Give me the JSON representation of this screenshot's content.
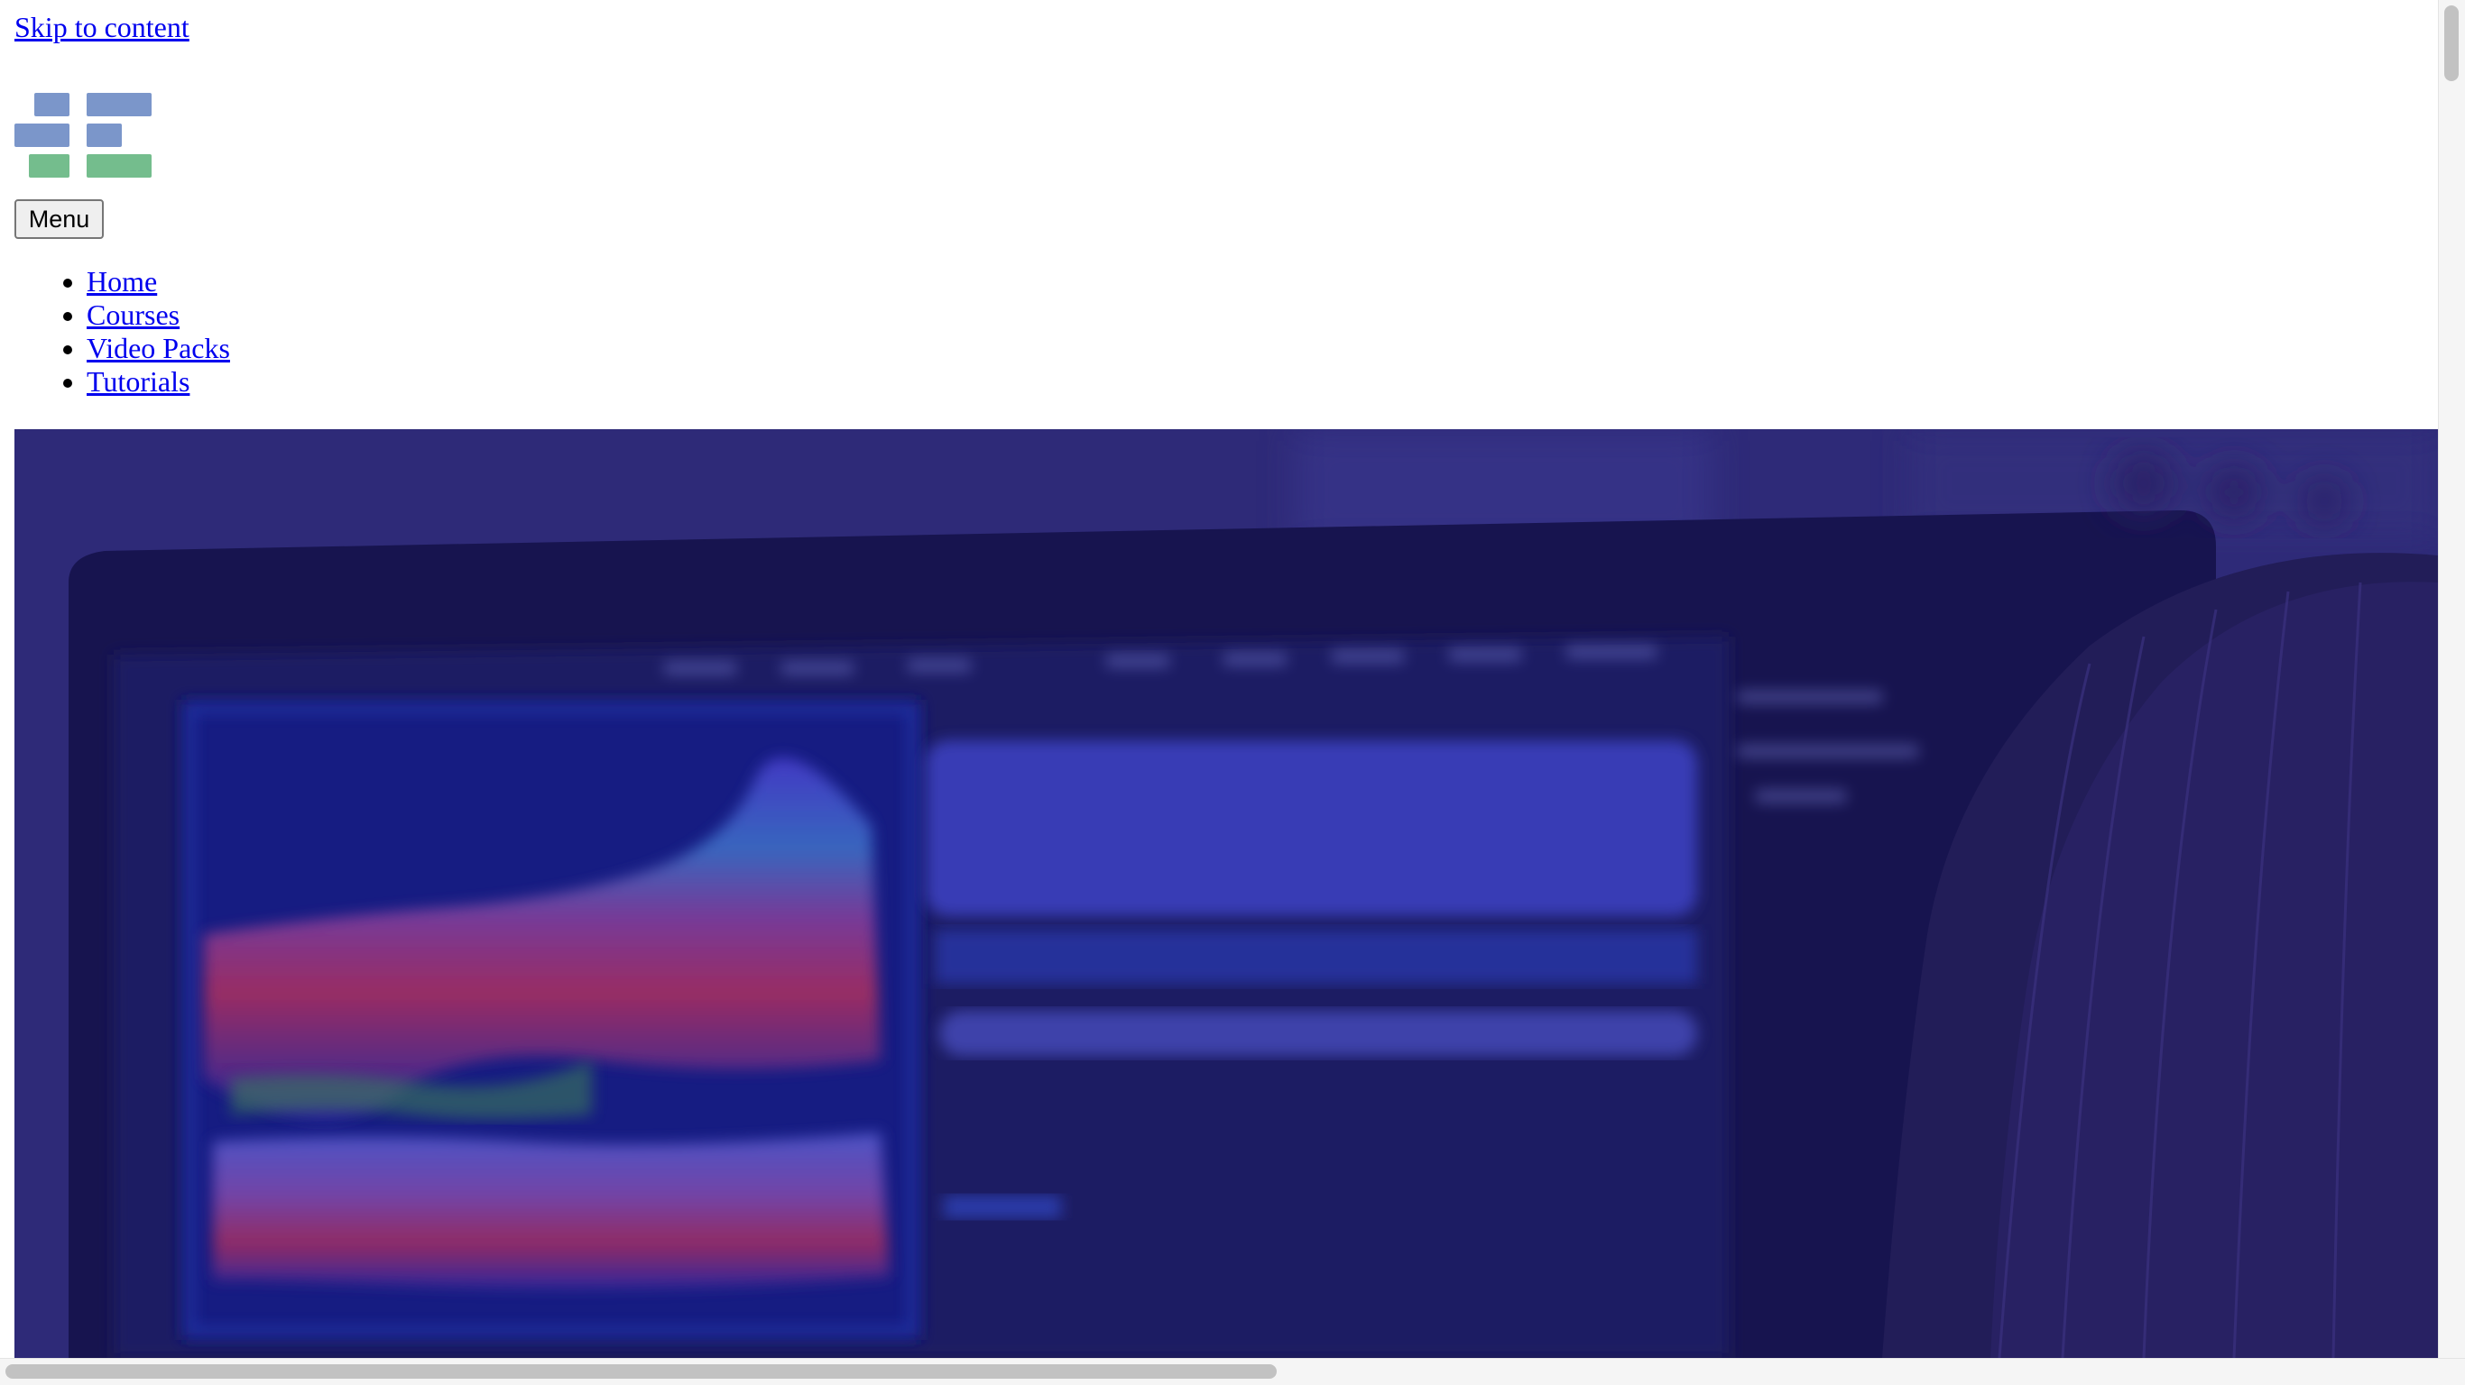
{
  "skip_link": {
    "label": "Skip to content"
  },
  "logo": {
    "icon": "brand-logo-blocks",
    "colors": {
      "blue": "#7b96ca",
      "green": "#74bd8d"
    }
  },
  "menu_button": {
    "label": "Menu"
  },
  "nav": {
    "items": [
      {
        "label": "Home"
      },
      {
        "label": "Courses"
      },
      {
        "label": "Video Packs"
      },
      {
        "label": "Tutorials"
      }
    ]
  },
  "hero": {
    "image": "person-viewing-data-dashboard-on-monitor",
    "overlay_color": "#24216b"
  }
}
